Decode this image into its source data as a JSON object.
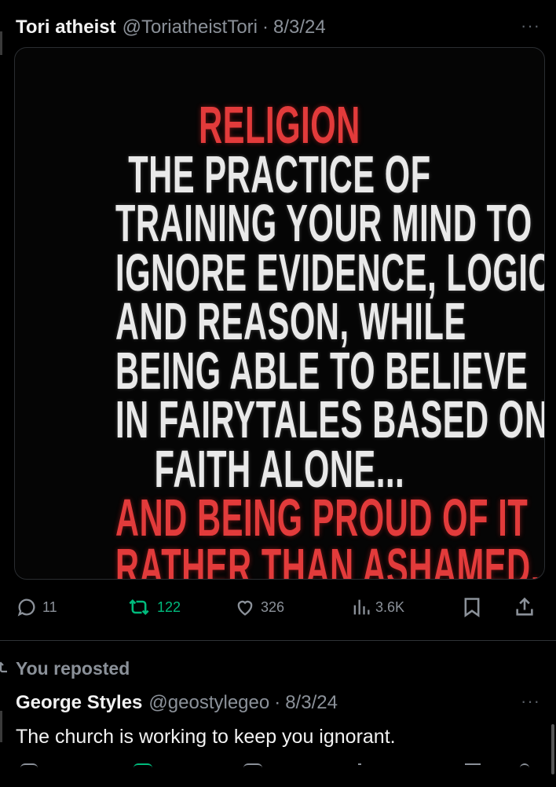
{
  "post": {
    "author_name": "Tori atheist",
    "author_handle": "@ToriatheistTori",
    "separator": "·",
    "date": "8/3/24",
    "more_label": "···",
    "media": {
      "lines": [
        {
          "text": "RELIGION",
          "color": "red"
        },
        {
          "text": "THE PRACTICE OF",
          "color": "white"
        },
        {
          "text": "TRAINING YOUR MIND TO",
          "color": "white"
        },
        {
          "text": "IGNORE EVIDENCE, LOGIC",
          "color": "white"
        },
        {
          "text": "AND REASON, WHILE",
          "color": "white"
        },
        {
          "text": "BEING ABLE TO BELIEVE",
          "color": "white"
        },
        {
          "text": "IN FAIRYTALES BASED ON",
          "color": "white"
        },
        {
          "text": "FAITH ALONE...",
          "color": "white"
        },
        {
          "text": "AND BEING PROUD OF IT",
          "color": "red"
        },
        {
          "text": "RATHER THAN ASHAMED.",
          "color": "red"
        }
      ]
    },
    "actions": {
      "replies": "11",
      "reposts": "122",
      "likes": "326",
      "views": "3.6K"
    }
  },
  "repost_notice": "You reposted",
  "post2": {
    "author_name": "George Styles",
    "author_handle": "@geostylegeo",
    "separator": "·",
    "date": "8/3/24",
    "more_label": "···",
    "text": "The church is working to keep you ignorant."
  },
  "colors": {
    "background": "#000000",
    "text": "#e7e9ea",
    "muted": "#8b9199",
    "repost_green": "#00ba7c",
    "media_red": "#e23b3b"
  }
}
